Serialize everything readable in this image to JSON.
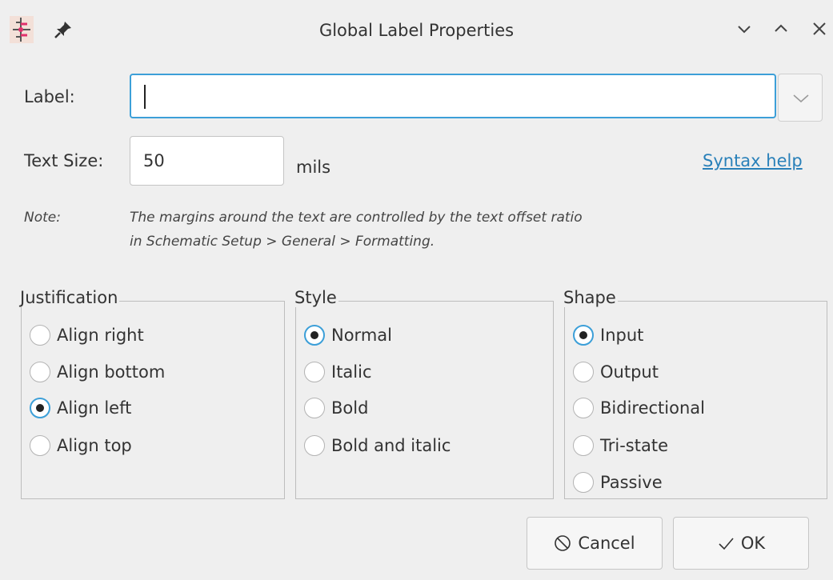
{
  "window": {
    "title": "Global Label Properties",
    "icons": {
      "app": "kicad-schematic-icon",
      "pin": "pin-icon",
      "minimize": "chevron-down-icon",
      "maximize": "chevron-up-icon",
      "close": "close-icon"
    }
  },
  "form": {
    "label_caption": "Label:",
    "label_value": "",
    "text_size_caption": "Text Size:",
    "text_size_value": "50",
    "text_size_unit": "mils",
    "syntax_help": "Syntax help",
    "note_caption": "Note:",
    "note_line1": "The margins around the text are controlled by the text offset ratio",
    "note_line2": "in Schematic Setup > General > Formatting."
  },
  "groups": {
    "justification": {
      "title": "Justification",
      "options": [
        {
          "label": "Align right",
          "checked": false
        },
        {
          "label": "Align bottom",
          "checked": false
        },
        {
          "label": "Align left",
          "checked": true
        },
        {
          "label": "Align top",
          "checked": false
        }
      ]
    },
    "style": {
      "title": "Style",
      "options": [
        {
          "label": "Normal",
          "checked": true
        },
        {
          "label": "Italic",
          "checked": false
        },
        {
          "label": "Bold",
          "checked": false
        },
        {
          "label": "Bold and italic",
          "checked": false
        }
      ]
    },
    "shape": {
      "title": "Shape",
      "options": [
        {
          "label": "Input",
          "checked": true
        },
        {
          "label": "Output",
          "checked": false
        },
        {
          "label": "Bidirectional",
          "checked": false
        },
        {
          "label": "Tri-state",
          "checked": false
        },
        {
          "label": "Passive",
          "checked": false
        }
      ]
    }
  },
  "buttons": {
    "cancel": "Cancel",
    "ok": "OK"
  },
  "colors": {
    "accent": "#3c9fd8",
    "link": "#2980b9",
    "background": "#efefef"
  }
}
